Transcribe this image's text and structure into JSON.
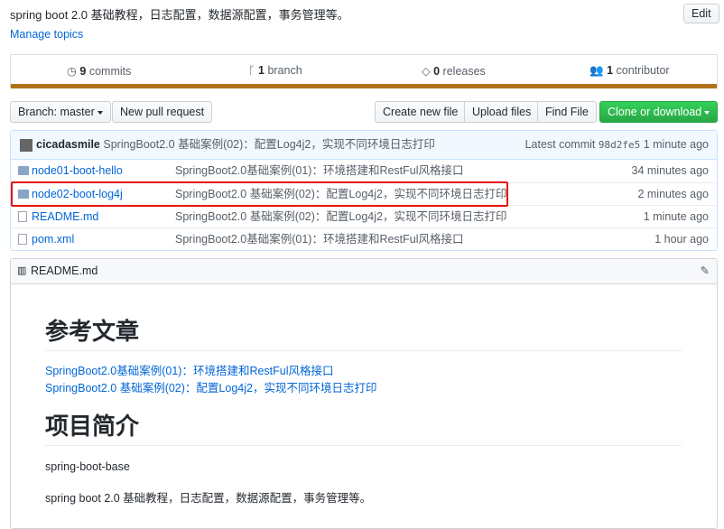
{
  "repo": {
    "description": "spring boot 2.0 基础教程，日志配置，数据源配置，事务管理等。",
    "edit": "Edit",
    "manage_topics": "Manage topics"
  },
  "stats": {
    "commits_n": "9",
    "commits": "commits",
    "branch_n": "1",
    "branch": "branch",
    "releases_n": "0",
    "releases": "releases",
    "contributors_n": "1",
    "contributors": "contributor",
    "language_color": "#b07219"
  },
  "toolbar": {
    "branch": "Branch: master",
    "new_pr": "New pull request",
    "create": "Create new file",
    "upload": "Upload files",
    "find": "Find File",
    "clone": "Clone or download"
  },
  "commit": {
    "author": "cicadasmile",
    "message": "SpringBoot2.0 基础案例(02)：配置Log4j2，实现不同环境日志打印",
    "latest_label": "Latest commit",
    "sha": "98d2fe5",
    "age": "1 minute ago"
  },
  "files": [
    {
      "name": "node01-boot-hello",
      "type": "folder",
      "message": "SpringBoot2.0基础案例(01)：环境搭建和RestFul风格接口",
      "age": "34 minutes ago"
    },
    {
      "name": "node02-boot-log4j",
      "type": "folder",
      "message": "SpringBoot2.0 基础案例(02)：配置Log4j2，实现不同环境日志打印",
      "age": "2 minutes ago"
    },
    {
      "name": "README.md",
      "type": "file",
      "message": "SpringBoot2.0 基础案例(02)：配置Log4j2，实现不同环境日志打印",
      "age": "1 minute ago"
    },
    {
      "name": "pom.xml",
      "type": "file",
      "message": "SpringBoot2.0基础案例(01)：环境搭建和RestFul风格接口",
      "age": "1 hour ago"
    }
  ],
  "readme": {
    "title": "README.md",
    "h1a": "参考文章",
    "link1": "SpringBoot2.0基础案例(01)：环境搭建和RestFul风格接口",
    "link2": "SpringBoot2.0 基础案例(02)：配置Log4j2，实现不同环境日志打印",
    "h1b": "项目简介",
    "p1": "spring-boot-base",
    "p2": "spring boot 2.0 基础教程，日志配置，数据源配置，事务管理等。"
  }
}
